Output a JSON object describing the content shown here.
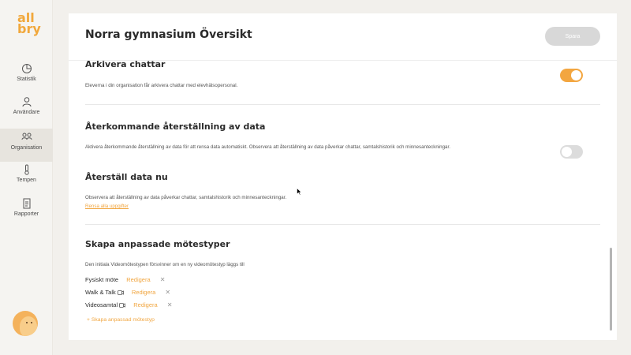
{
  "logo": {
    "line1": "all",
    "line2": "bry"
  },
  "sidebar": {
    "items": [
      {
        "label": "Statistik",
        "icon": "pie-chart-icon"
      },
      {
        "label": "Användare",
        "icon": "user-icon"
      },
      {
        "label": "Organisation",
        "icon": "organisation-icon"
      },
      {
        "label": "Tempen",
        "icon": "thermometer-icon"
      },
      {
        "label": "Rapporter",
        "icon": "report-icon"
      }
    ],
    "active": "Organisation"
  },
  "header": {
    "title": "Norra gymnasium Översikt",
    "save_label": "Spara"
  },
  "sections": {
    "archive": {
      "title": "Arkivera chattar",
      "description": "Eleverna i din organisation får arkivera chattar med elevhälsopersonal.",
      "toggle_on": true
    },
    "recurring_reset": {
      "title": "Återkommande återställning av data",
      "description": "Aktivera återkommande återställning av data för att rensa data automatiskt. Observera att återställning av data påverkar chattar, samtalshistorik och minnesanteckningar.",
      "toggle_on": false
    },
    "reset_now": {
      "title": "Återställ data nu",
      "description": "Observera att återställning av data påverkar chattar, samtalshistorik och minnesanteckningar.",
      "link": "Rensa alla uppgifter"
    },
    "meeting_types": {
      "title": "Skapa anpassade mötestyper",
      "description": "Den initiala Videomötestypen försvinner om en ny videomötestyp läggs till",
      "items": [
        {
          "name": "Fysiskt möte",
          "video": false,
          "edit": "Redigera"
        },
        {
          "name": "Walk & Talk",
          "video": true,
          "edit": "Redigera"
        },
        {
          "name": "Videosamtal",
          "video": true,
          "edit": "Redigera"
        }
      ],
      "add_label": "+ Skapa anpassad mötestyp"
    }
  },
  "colors": {
    "accent": "#f3a640",
    "background": "#f2f0ec"
  }
}
